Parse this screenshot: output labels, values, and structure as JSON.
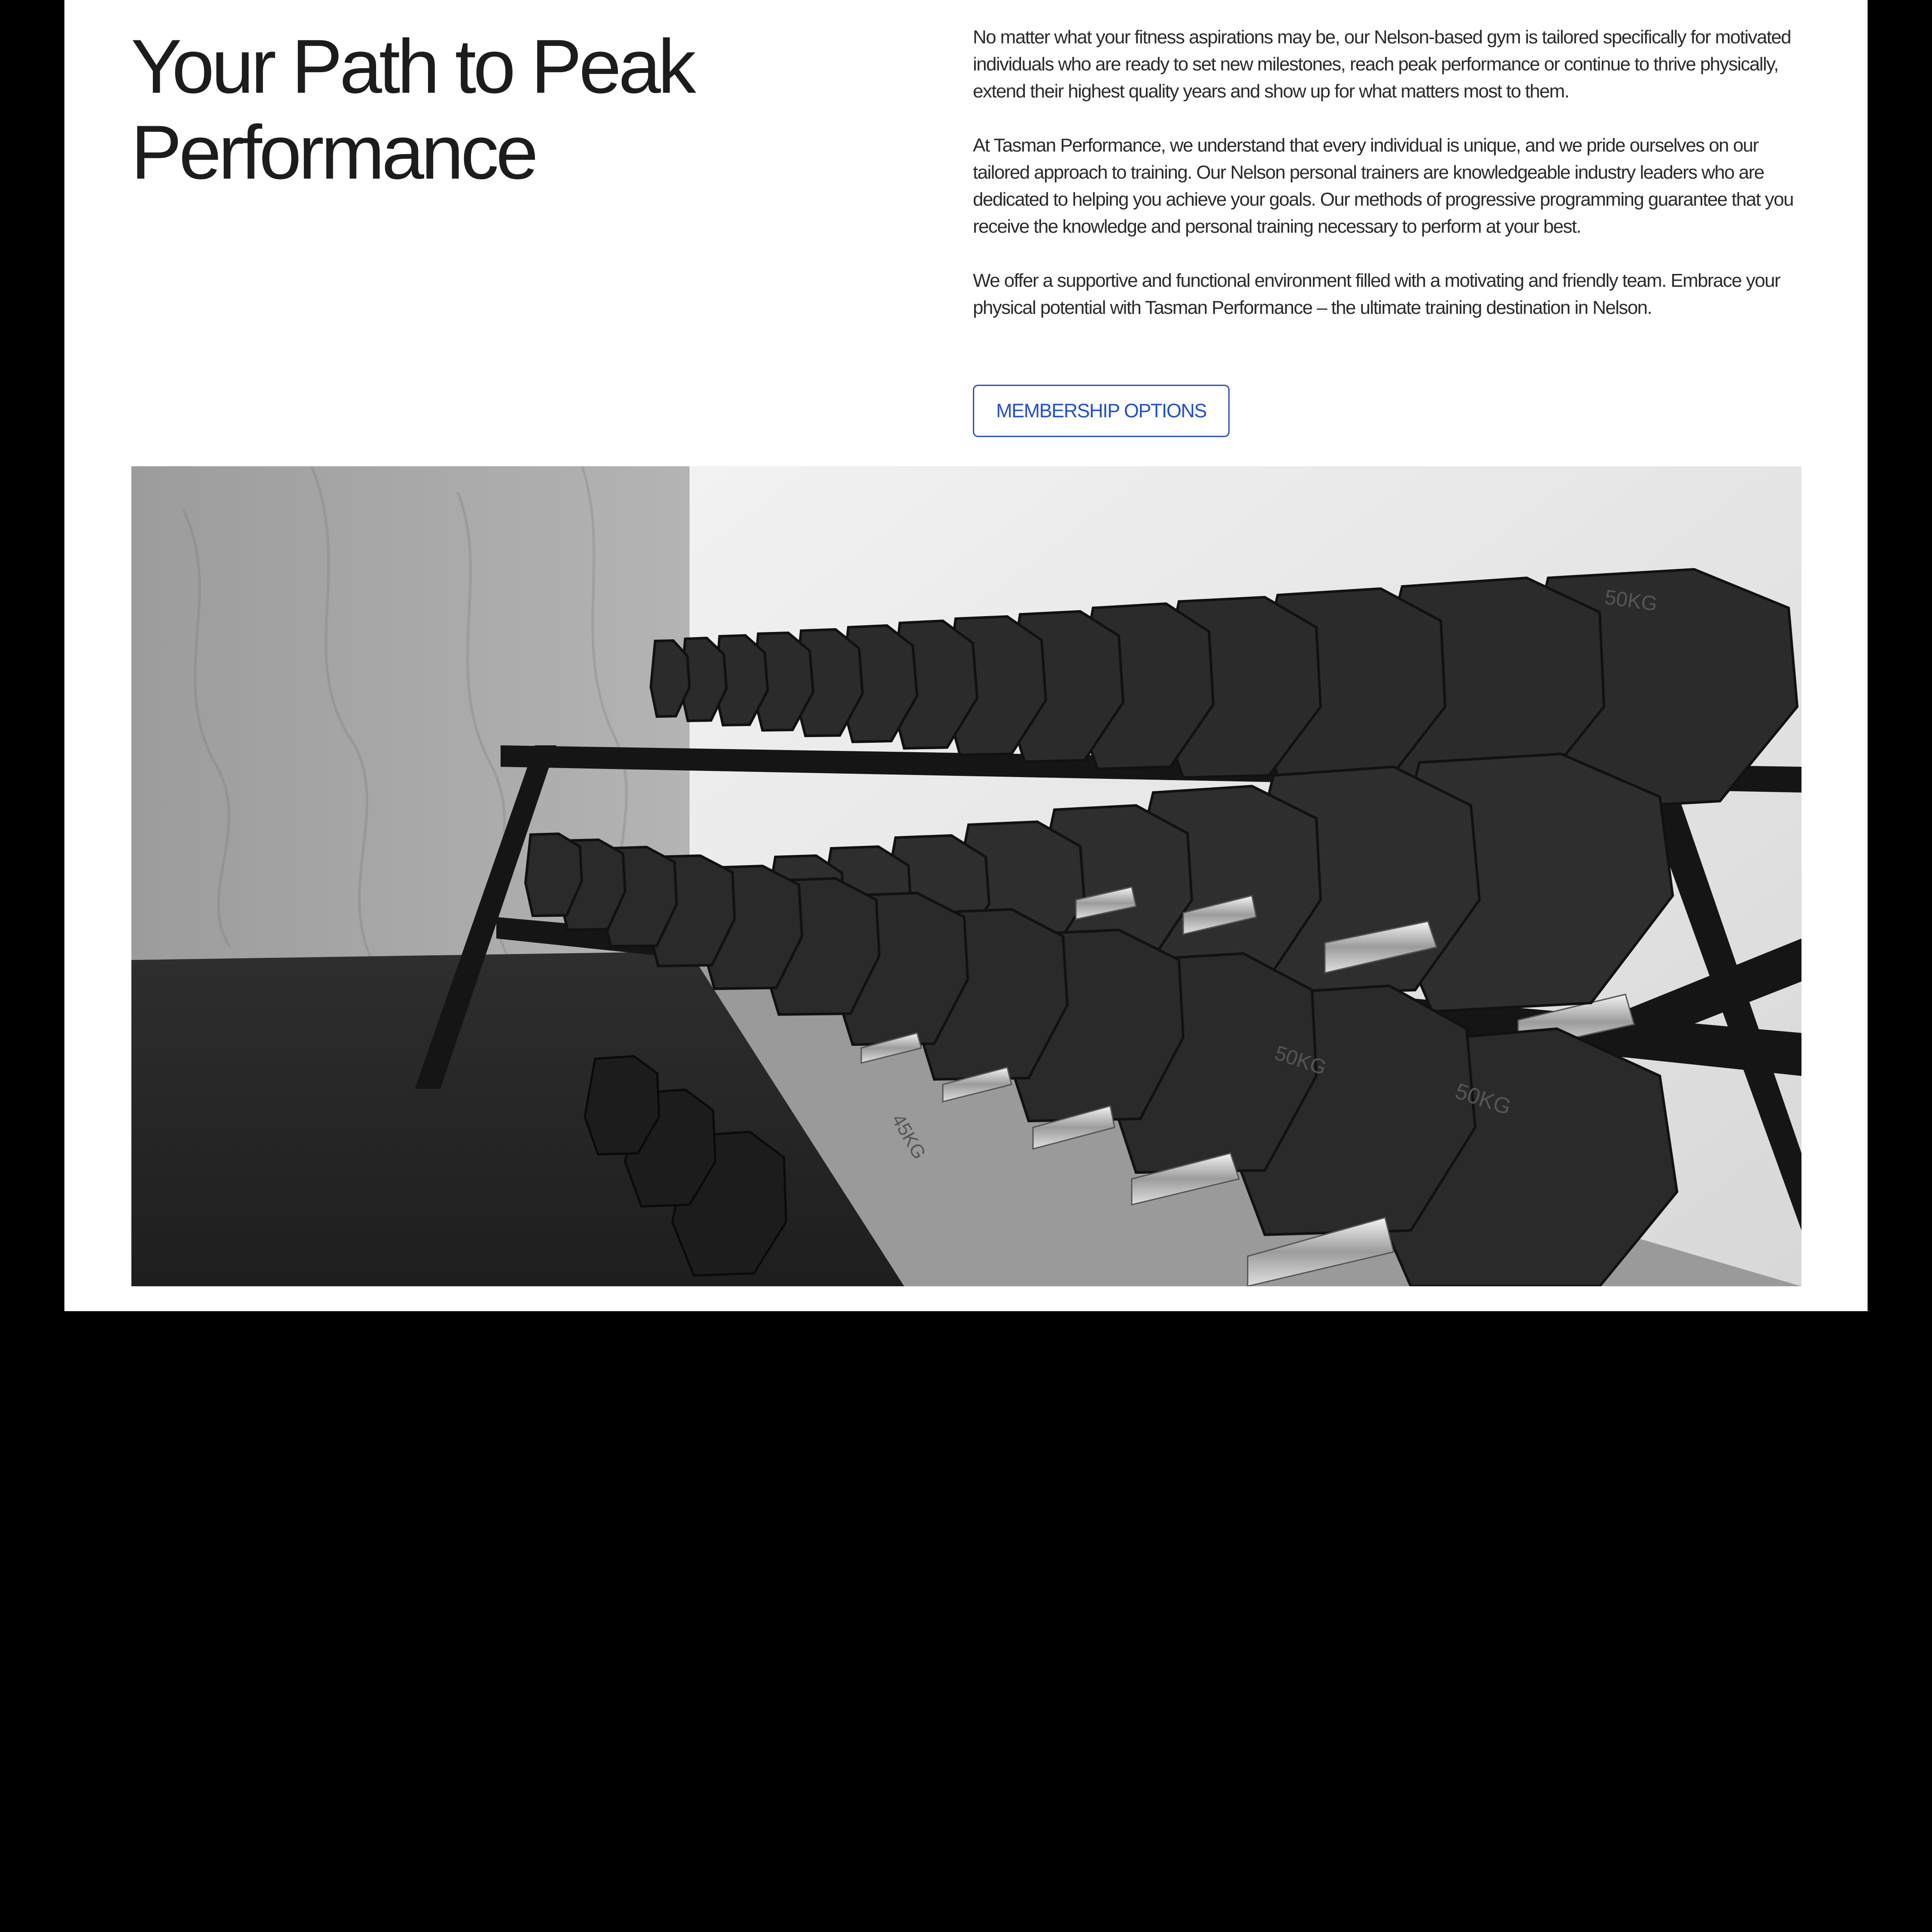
{
  "colors": {
    "page_background": "#000000",
    "panel_background": "#ffffff",
    "heading_text": "#1c1c1c",
    "body_text": "#2b2b2b",
    "accent": "#2450c7"
  },
  "hero": {
    "title_line_1": "Your Path to Peak",
    "title_line_2": "Performance"
  },
  "intro": {
    "paragraph_1": "No matter what your fitness aspirations may be, our Nelson-based gym is tailored specifically for motivated individuals who are ready to set new milestones, reach peak performance or continue to thrive physically, extend their highest quality years and show up for what matters most to them.",
    "paragraph_2": "At Tasman Performance, we understand that every individual is unique, and we pride ourselves on our tailored approach to training. Our Nelson personal trainers are knowledgeable industry leaders who are dedicated to helping you achieve your goals. Our methods of progressive programming guarantee that you receive the knowledge and personal training necessary to perform at your best.",
    "paragraph_3": "We offer a supportive and functional environment filled with a motivating and friendly team. Embrace your physical potential with Tasman Performance – the ultimate training destination in Nelson."
  },
  "cta": {
    "membership_label": "MEMBERSHIP OPTIONS"
  },
  "photo": {
    "subject": "dumbbell-rack",
    "dumbbell_labels": [
      "45KG",
      "50KG",
      "50KG"
    ]
  }
}
